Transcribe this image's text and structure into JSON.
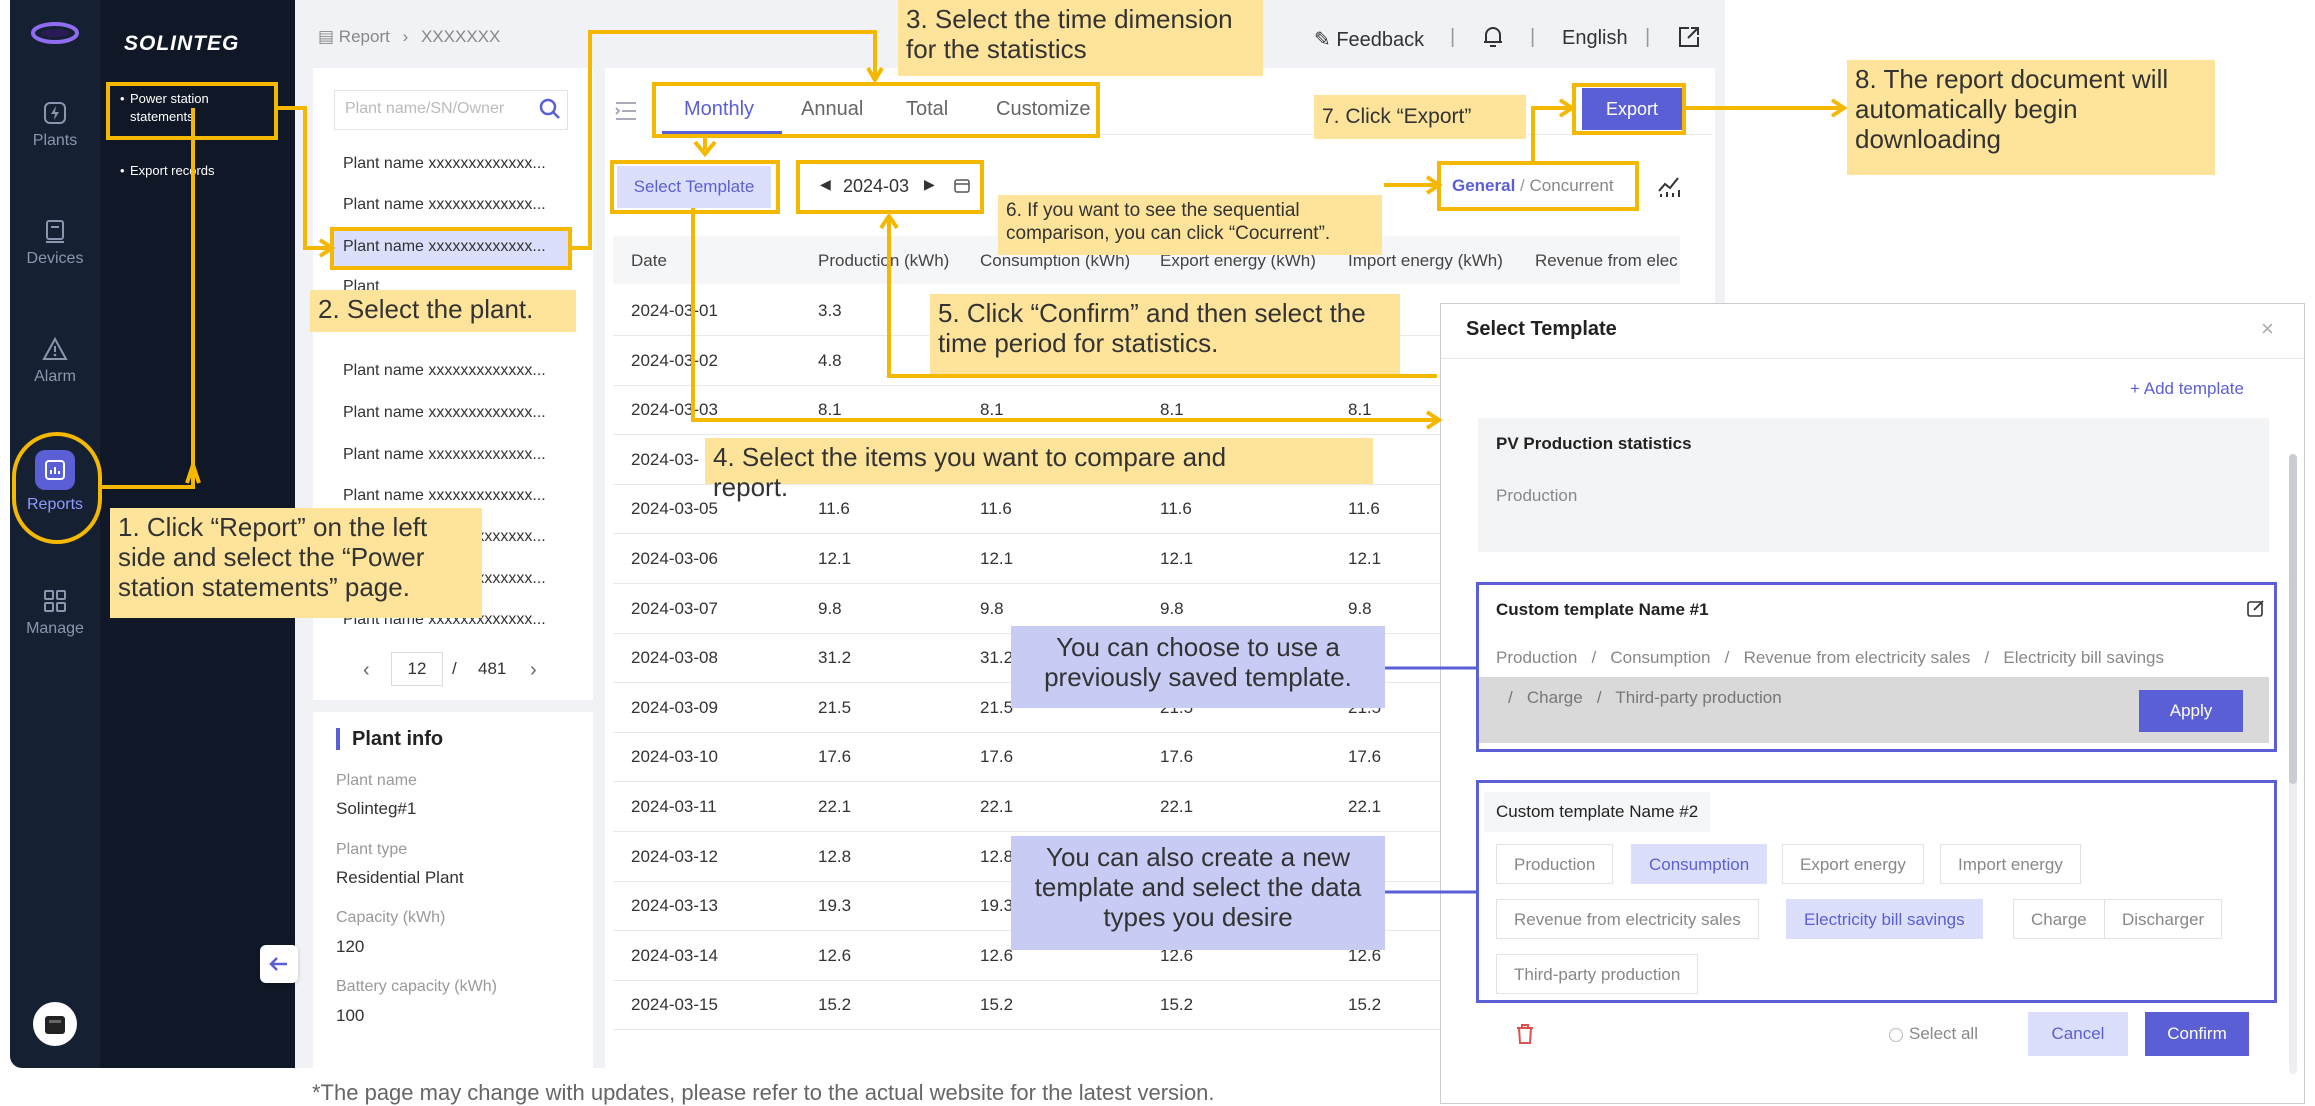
{
  "sidebar": {
    "items": [
      {
        "icon": "bolt-icon",
        "label": "Plants"
      },
      {
        "icon": "device-icon",
        "label": "Devices"
      },
      {
        "icon": "warning-icon",
        "label": "Alarm"
      },
      {
        "icon": "chart-icon",
        "label": "Reports",
        "active": true
      },
      {
        "icon": "grid-icon",
        "label": "Manage"
      }
    ]
  },
  "subnav": {
    "brand": "SOLINTEG",
    "items": [
      "Power station statements",
      "Export records"
    ]
  },
  "header": {
    "breadcrumb": [
      "Report",
      "XXXXXXX"
    ],
    "feedback": "Feedback",
    "language": "English"
  },
  "plant_list": {
    "search_placeholder": "Plant name/SN/Owner",
    "items": [
      "Plant name xxxxxxxxxxxxx...",
      "Plant name xxxxxxxxxxxxx...",
      "Plant name xxxxxxxxxxxxx...",
      "Plant name xxxxxxxxxxxxx...",
      "Plant name xxxxxxxxxxxxx...",
      "Plant name xxxxxxxxxxxxx...",
      "Plant name xxxxxxxxxxxxx...",
      "Plant name xxxxxxxxxxxxx...",
      "Plant name xxxxxxxxxxxxx...",
      "Plant name xxxxxxxxxxxxx..."
    ],
    "partial_item": "Plant",
    "page_current": "12",
    "page_sep": "/",
    "page_total": "481"
  },
  "plant_info": {
    "title": "Plant info",
    "fields": [
      {
        "label": "Plant name",
        "value": "Solinteg#1"
      },
      {
        "label": "Plant type",
        "value": "Residential Plant"
      },
      {
        "label": "Capacity (kWh)",
        "value": "120"
      },
      {
        "label": "Battery capacity (kWh)",
        "value": "100"
      }
    ]
  },
  "report": {
    "tabs": [
      "Monthly",
      "Annual",
      "Total",
      "Customize"
    ],
    "active_tab": "Monthly",
    "select_template": "Select Template",
    "month": "2024-03",
    "mode_general": "General",
    "mode_sep": "/",
    "mode_concurrent": "Concurrent",
    "export": "Export",
    "columns": [
      "Date",
      "Production (kWh)",
      "Consumption (kWh)",
      "Export energy (kWh)",
      "Import energy (kWh)",
      "Revenue from elec"
    ],
    "rows": [
      {
        "date": "2024-03-01",
        "v": [
          "3.3",
          "",
          "",
          ""
        ]
      },
      {
        "date": "2024-03-02",
        "v": [
          "4.8",
          "",
          "",
          ""
        ]
      },
      {
        "date": "2024-03-03",
        "v": [
          "8.1",
          "8.1",
          "8.1",
          "8.1"
        ]
      },
      {
        "date": "2024-03-",
        "v": [
          "",
          "",
          "",
          ""
        ]
      },
      {
        "date": "2024-03-05",
        "v": [
          "11.6",
          "11.6",
          "11.6",
          "11.6"
        ]
      },
      {
        "date": "2024-03-06",
        "v": [
          "12.1",
          "12.1",
          "12.1",
          "12.1"
        ]
      },
      {
        "date": "2024-03-07",
        "v": [
          "9.8",
          "9.8",
          "9.8",
          "9.8"
        ]
      },
      {
        "date": "2024-03-08",
        "v": [
          "31.2",
          "31.2",
          "",
          ""
        ]
      },
      {
        "date": "2024-03-09",
        "v": [
          "21.5",
          "21.5",
          "21.5",
          "21.5"
        ]
      },
      {
        "date": "2024-03-10",
        "v": [
          "17.6",
          "17.6",
          "17.6",
          "17.6"
        ]
      },
      {
        "date": "2024-03-11",
        "v": [
          "22.1",
          "22.1",
          "22.1",
          "22.1"
        ]
      },
      {
        "date": "2024-03-12",
        "v": [
          "12.8",
          "12.8",
          "",
          ""
        ]
      },
      {
        "date": "2024-03-13",
        "v": [
          "19.3",
          "19.3",
          "",
          ""
        ]
      },
      {
        "date": "2024-03-14",
        "v": [
          "12.6",
          "12.6",
          "12.6",
          "12.6"
        ]
      },
      {
        "date": "2024-03-15",
        "v": [
          "15.2",
          "15.2",
          "15.2",
          "15.2"
        ]
      }
    ]
  },
  "modal": {
    "title": "Select Template",
    "add_template": "Add template",
    "pv_title": "PV Production statistics",
    "pv_item": "Production",
    "t1_name": "Custom template Name #1",
    "t1_items_line1": "Production   /   Consumption   /   Revenue from electricity sales   /   Electricity bill savings",
    "t1_items_line2": "/   Charge   /   Third-party production",
    "apply": "Apply",
    "t2_name": "Custom template Name #2",
    "chips": [
      {
        "label": "Production",
        "selected": false
      },
      {
        "label": "Consumption",
        "selected": true
      },
      {
        "label": "Export energy",
        "selected": false
      },
      {
        "label": "Import energy",
        "selected": false
      },
      {
        "label": "Revenue from electricity sales",
        "selected": false
      },
      {
        "label": "Electricity bill savings",
        "selected": true
      },
      {
        "label": "Charge",
        "selected": false
      },
      {
        "label": "Discharger",
        "selected": false
      },
      {
        "label": "Third-party production",
        "selected": false
      }
    ],
    "select_all": "Select all",
    "cancel": "Cancel",
    "confirm": "Confirm"
  },
  "annotations": {
    "n1": "1. Click “Report” on the left side and select the “Power station statements” page.",
    "n2": "2. Select the plant.",
    "n3": "3. Select the time dimension for the statistics",
    "n4": "4. Select the items you want to compare and report.",
    "n5": "5. Click “Confirm” and then select the time period for statistics.",
    "n6": "6. If you want to see the sequential comparison, you can click “Cocurrent”.",
    "n7": "7. Click “Export”",
    "n8": "8. The report document will automatically begin downloading",
    "tip_saved": "You can choose to use a previously saved template.",
    "tip_new": "You can also create a new template and select the data types you desire"
  },
  "footnote": "*The page may change with updates, please refer to the actual website for the latest version.",
  "colors": {
    "accent": "#5b5fd6",
    "annotation": "#f5b800",
    "note_bg": "#fde49a",
    "tip_bg": "#c8ccf5",
    "rail": "#162033"
  }
}
